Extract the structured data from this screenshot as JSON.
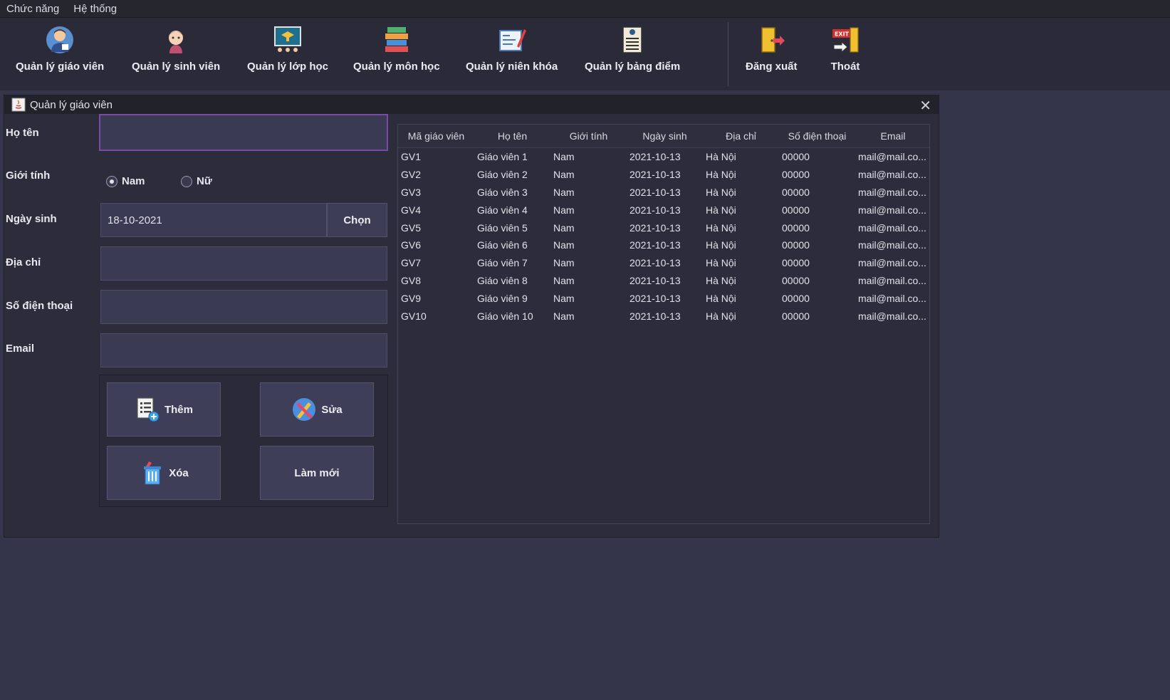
{
  "menu": [
    "Chức năng",
    "Hệ thống"
  ],
  "toolbar": [
    {
      "label": "Quản lý giáo viên",
      "icon": "teacher-icon"
    },
    {
      "label": "Quản lý sinh viên",
      "icon": "student-icon"
    },
    {
      "label": "Quản lý lớp học",
      "icon": "classroom-icon"
    },
    {
      "label": "Quản lý môn học",
      "icon": "books-icon"
    },
    {
      "label": "Quản lý niên khóa",
      "icon": "calendar-icon"
    },
    {
      "label": "Quản lý bảng điểm",
      "icon": "scoreboard-icon"
    },
    {
      "label": "Đăng xuất",
      "icon": "logout-icon"
    },
    {
      "label": "Thoát",
      "icon": "exit-icon"
    }
  ],
  "window": {
    "title": "Quản lý giáo viên"
  },
  "form": {
    "name_label": "Họ tên",
    "name_value": "",
    "gender_label": "Giới tính",
    "gender_male": "Nam",
    "gender_female": "Nữ",
    "gender_selected": "Nam",
    "dob_label": "Ngày sinh",
    "dob_value": "18-10-2021",
    "choose_label": "Chọn",
    "address_label": "Địa chỉ",
    "address_value": "",
    "phone_label": "Số điện thoại",
    "phone_value": "",
    "email_label": "Email",
    "email_value": ""
  },
  "actions": {
    "add": "Thêm",
    "edit": "Sửa",
    "delete": "Xóa",
    "refresh": "Làm mới"
  },
  "table": {
    "columns": [
      "Mã giáo viên",
      "Họ tên",
      "Giới tính",
      "Ngày sinh",
      "Địa chỉ",
      "Số điện thoại",
      "Email"
    ],
    "rows": [
      [
        "GV1",
        "Giáo viên 1",
        "Nam",
        "2021-10-13",
        "Hà Nội",
        "00000",
        "mail@mail.co..."
      ],
      [
        "GV2",
        "Giáo viên 2",
        "Nam",
        "2021-10-13",
        "Hà Nội",
        "00000",
        "mail@mail.co..."
      ],
      [
        "GV3",
        "Giáo viên 3",
        "Nam",
        "2021-10-13",
        "Hà Nội",
        "00000",
        "mail@mail.co..."
      ],
      [
        "GV4",
        "Giáo viên 4",
        "Nam",
        "2021-10-13",
        "Hà Nội",
        "00000",
        "mail@mail.co..."
      ],
      [
        "GV5",
        "Giáo viên 5",
        "Nam",
        "2021-10-13",
        "Hà Nội",
        "00000",
        "mail@mail.co..."
      ],
      [
        "GV6",
        "Giáo viên 6",
        "Nam",
        "2021-10-13",
        "Hà Nội",
        "00000",
        "mail@mail.co..."
      ],
      [
        "GV7",
        "Giáo viên 7",
        "Nam",
        "2021-10-13",
        "Hà Nội",
        "00000",
        "mail@mail.co..."
      ],
      [
        "GV8",
        "Giáo viên 8",
        "Nam",
        "2021-10-13",
        "Hà Nội",
        "00000",
        "mail@mail.co..."
      ],
      [
        "GV9",
        "Giáo viên 9",
        "Nam",
        "2021-10-13",
        "Hà Nội",
        "00000",
        "mail@mail.co..."
      ],
      [
        "GV10",
        "Giáo viên 10",
        "Nam",
        "2021-10-13",
        "Hà Nội",
        "00000",
        "mail@mail.co..."
      ]
    ]
  },
  "colors": {
    "background": "#34344a",
    "toolbar": "#2a2a38",
    "focus_border": "#7a4aa8"
  }
}
